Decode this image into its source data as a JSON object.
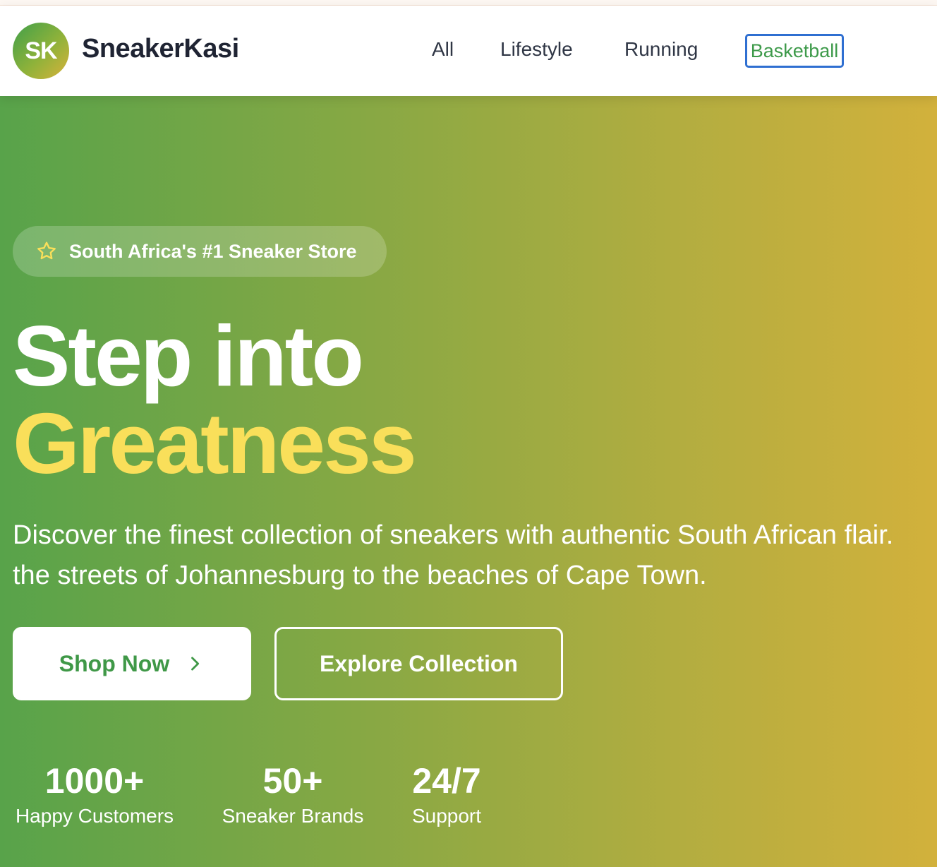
{
  "header": {
    "logo_initials": "SK",
    "brand_name": "SneakerKasi",
    "nav": [
      {
        "label": "All"
      },
      {
        "label": "Lifestyle"
      },
      {
        "label": "Running"
      },
      {
        "label": "Basketball"
      }
    ]
  },
  "hero": {
    "badge": {
      "icon": "star-icon",
      "text": "South Africa's #1 Sneaker Store"
    },
    "headline_line1": "Step into",
    "headline_line2": "Greatness",
    "description_line1": "Discover the finest collection of sneakers with authentic South African flair.",
    "description_line2": "the streets of Johannesburg to the beaches of Cape Town.",
    "primary_button": {
      "label": "Shop Now",
      "icon": "chevron-right-icon"
    },
    "secondary_button": {
      "label": "Explore Collection"
    },
    "stats": [
      {
        "value": "1000+",
        "label": "Happy Customers"
      },
      {
        "value": "50+",
        "label": "Sneaker Brands"
      },
      {
        "value": "24/7",
        "label": "Support"
      }
    ]
  },
  "colors": {
    "accent_green": "#3f9847",
    "accent_yellow": "#f9df5a",
    "gradient_start": "#58a34a",
    "gradient_end": "#d2b13c",
    "focus_outline": "#2f6fd1"
  }
}
